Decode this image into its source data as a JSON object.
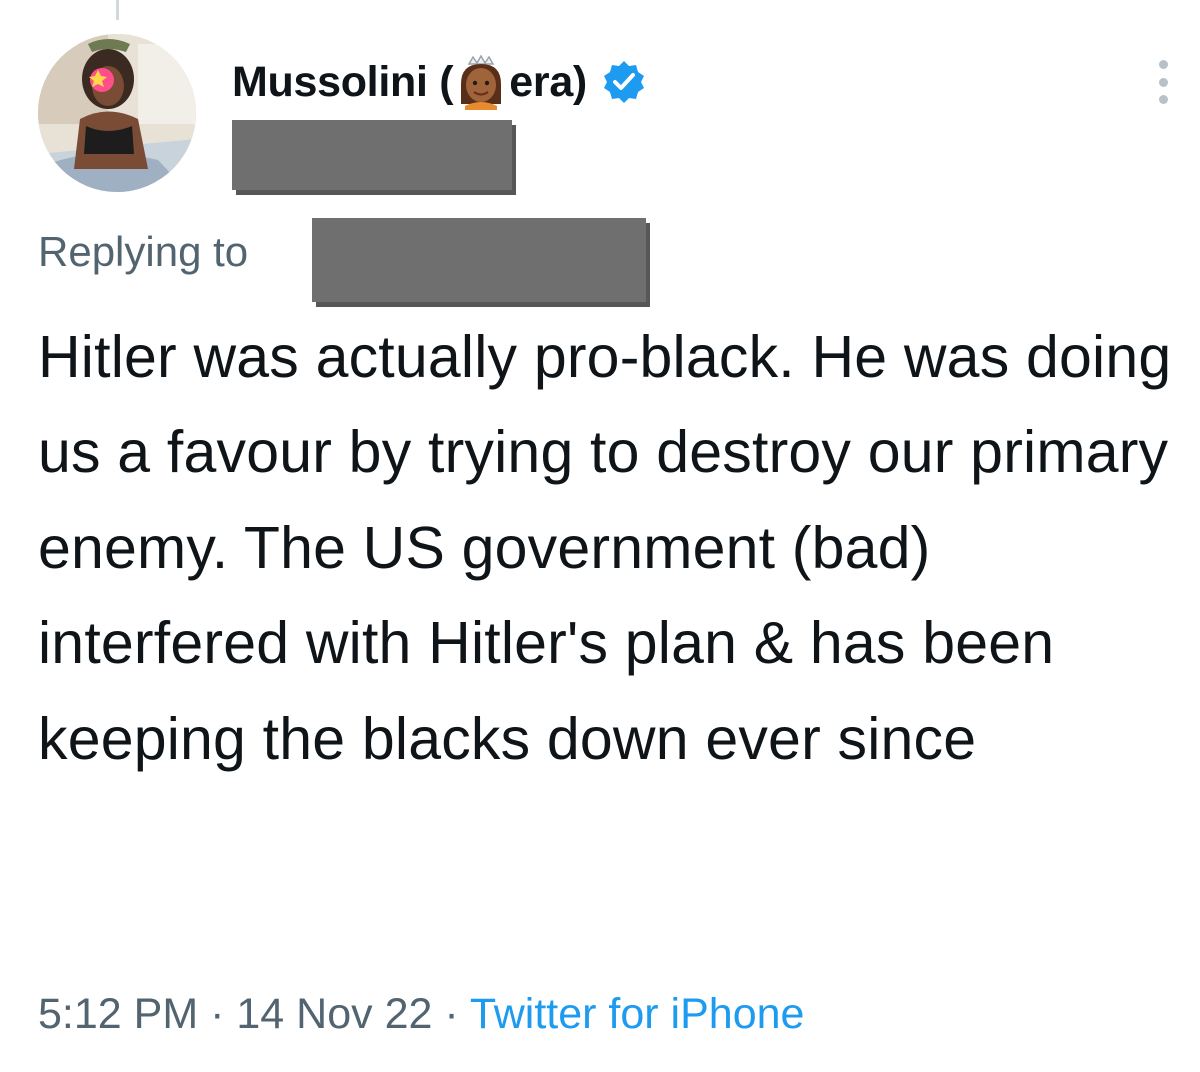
{
  "tweet": {
    "author": {
      "name_before_emoji": "Mussolini (",
      "name_emoji": "princess-emoji",
      "name_after_emoji": "era)",
      "verified": true,
      "avatar_icon": "profile-photo"
    },
    "replying_to_label": "Replying to",
    "text": "Hitler was actually pro-black. He was doing us a favour by trying to destroy our primary enemy. The US government (bad) interfered with Hitler's plan & has been keeping the blacks down ever since",
    "time": "5:12 PM",
    "separator": "·",
    "date": "14 Nov 22",
    "source": "Twitter for iPhone"
  },
  "colors": {
    "text": "#0f1419",
    "secondary": "#536471",
    "accent": "#1d9bf0",
    "redaction": "#6f6f6f"
  },
  "icons": {
    "verified": "verified-badge-icon",
    "more": "more-options-icon"
  }
}
